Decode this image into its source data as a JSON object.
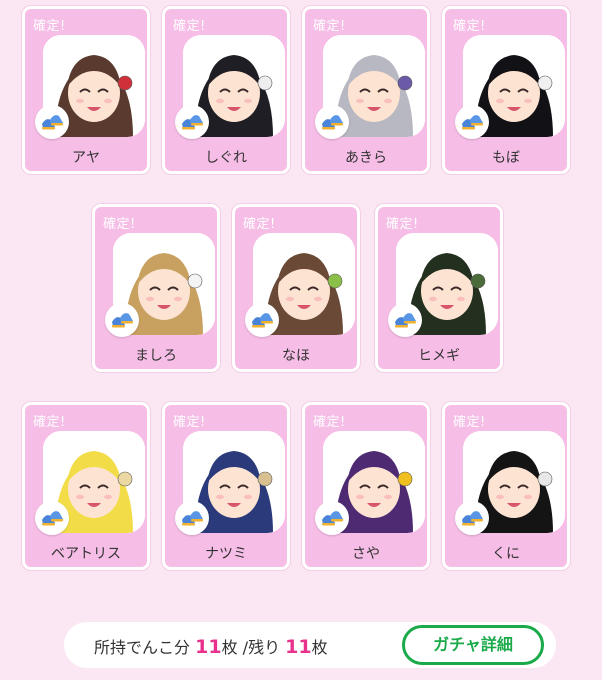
{
  "cards": [
    {
      "tag": "確定!",
      "name": "アヤ",
      "hair": "#5a3a2e",
      "acc": "#d0303a"
    },
    {
      "tag": "確定!",
      "name": "しぐれ",
      "hair": "#1e1e24",
      "acc": "#eeeeee"
    },
    {
      "tag": "確定!",
      "name": "あきら",
      "hair": "#b8b8c2",
      "acc": "#6a5aa8"
    },
    {
      "tag": "確定!",
      "name": "もぼ",
      "hair": "#121216",
      "acc": "#f0f0f0"
    },
    {
      "tag": "確定!",
      "name": "ましろ",
      "hair": "#c8a060",
      "acc": "#f4f4f4"
    },
    {
      "tag": "確定!",
      "name": "なほ",
      "hair": "#6a4a36",
      "acc": "#8ac048"
    },
    {
      "tag": "確定!",
      "name": "ヒメギ",
      "hair": "#24301f",
      "acc": "#4b6b3a"
    },
    {
      "tag": "確定!",
      "name": "ベアトリス",
      "hair": "#f2dc48",
      "acc": "#ecd8a2"
    },
    {
      "tag": "確定!",
      "name": "ナツミ",
      "hair": "#2a3a7a",
      "acc": "#d8c090"
    },
    {
      "tag": "確定!",
      "name": "さや",
      "hair": "#4e2a72",
      "acc": "#f0c020"
    },
    {
      "tag": "確定!",
      "name": "くに",
      "hair": "#141414",
      "acc": "#e8e8e8"
    }
  ],
  "footer": {
    "owned_label": "所持でんこ分",
    "owned_count": "11",
    "owned_unit": "枚",
    "remaining_label": "/残り",
    "remaining_count": "11",
    "remaining_unit": "枚",
    "button_label": "ガチャ詳細"
  },
  "colors": {
    "background": "#fbe6f3",
    "card": "#f6bde6",
    "accent_pink": "#e8318c",
    "accent_green": "#1aaa4a"
  }
}
